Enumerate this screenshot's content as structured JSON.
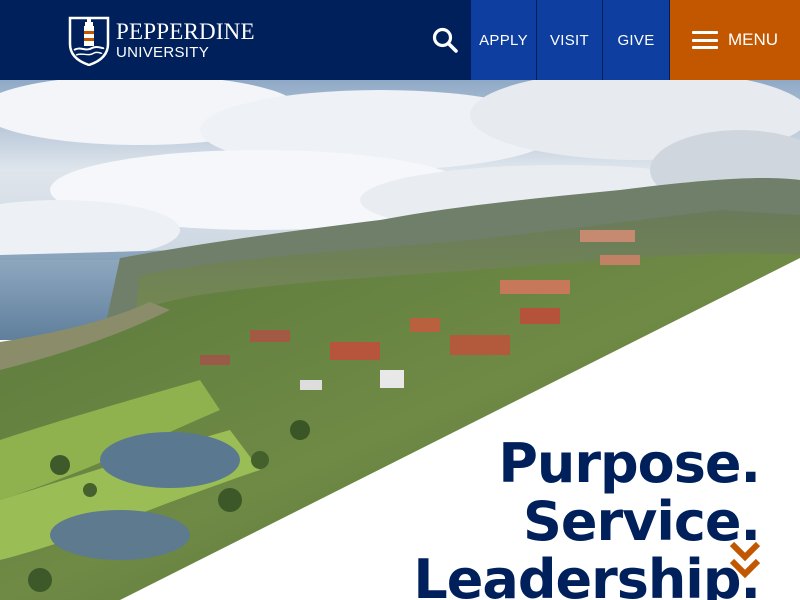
{
  "header": {
    "logo": {
      "name": "PEPPERDINE",
      "sub": "UNIVERSITY"
    },
    "nav": {
      "apply": "APPLY",
      "visit": "VISIT",
      "give": "GIVE"
    },
    "menu_label": "MENU"
  },
  "hero": {
    "tagline": [
      "Purpose.",
      "Service.",
      "Leadership."
    ]
  },
  "colors": {
    "navy": "#00205c",
    "blue": "#0d3ea0",
    "orange": "#c25700"
  },
  "icons": [
    "logo-mark-icon",
    "search-icon",
    "hamburger-icon",
    "double-chevron-down-icon"
  ]
}
